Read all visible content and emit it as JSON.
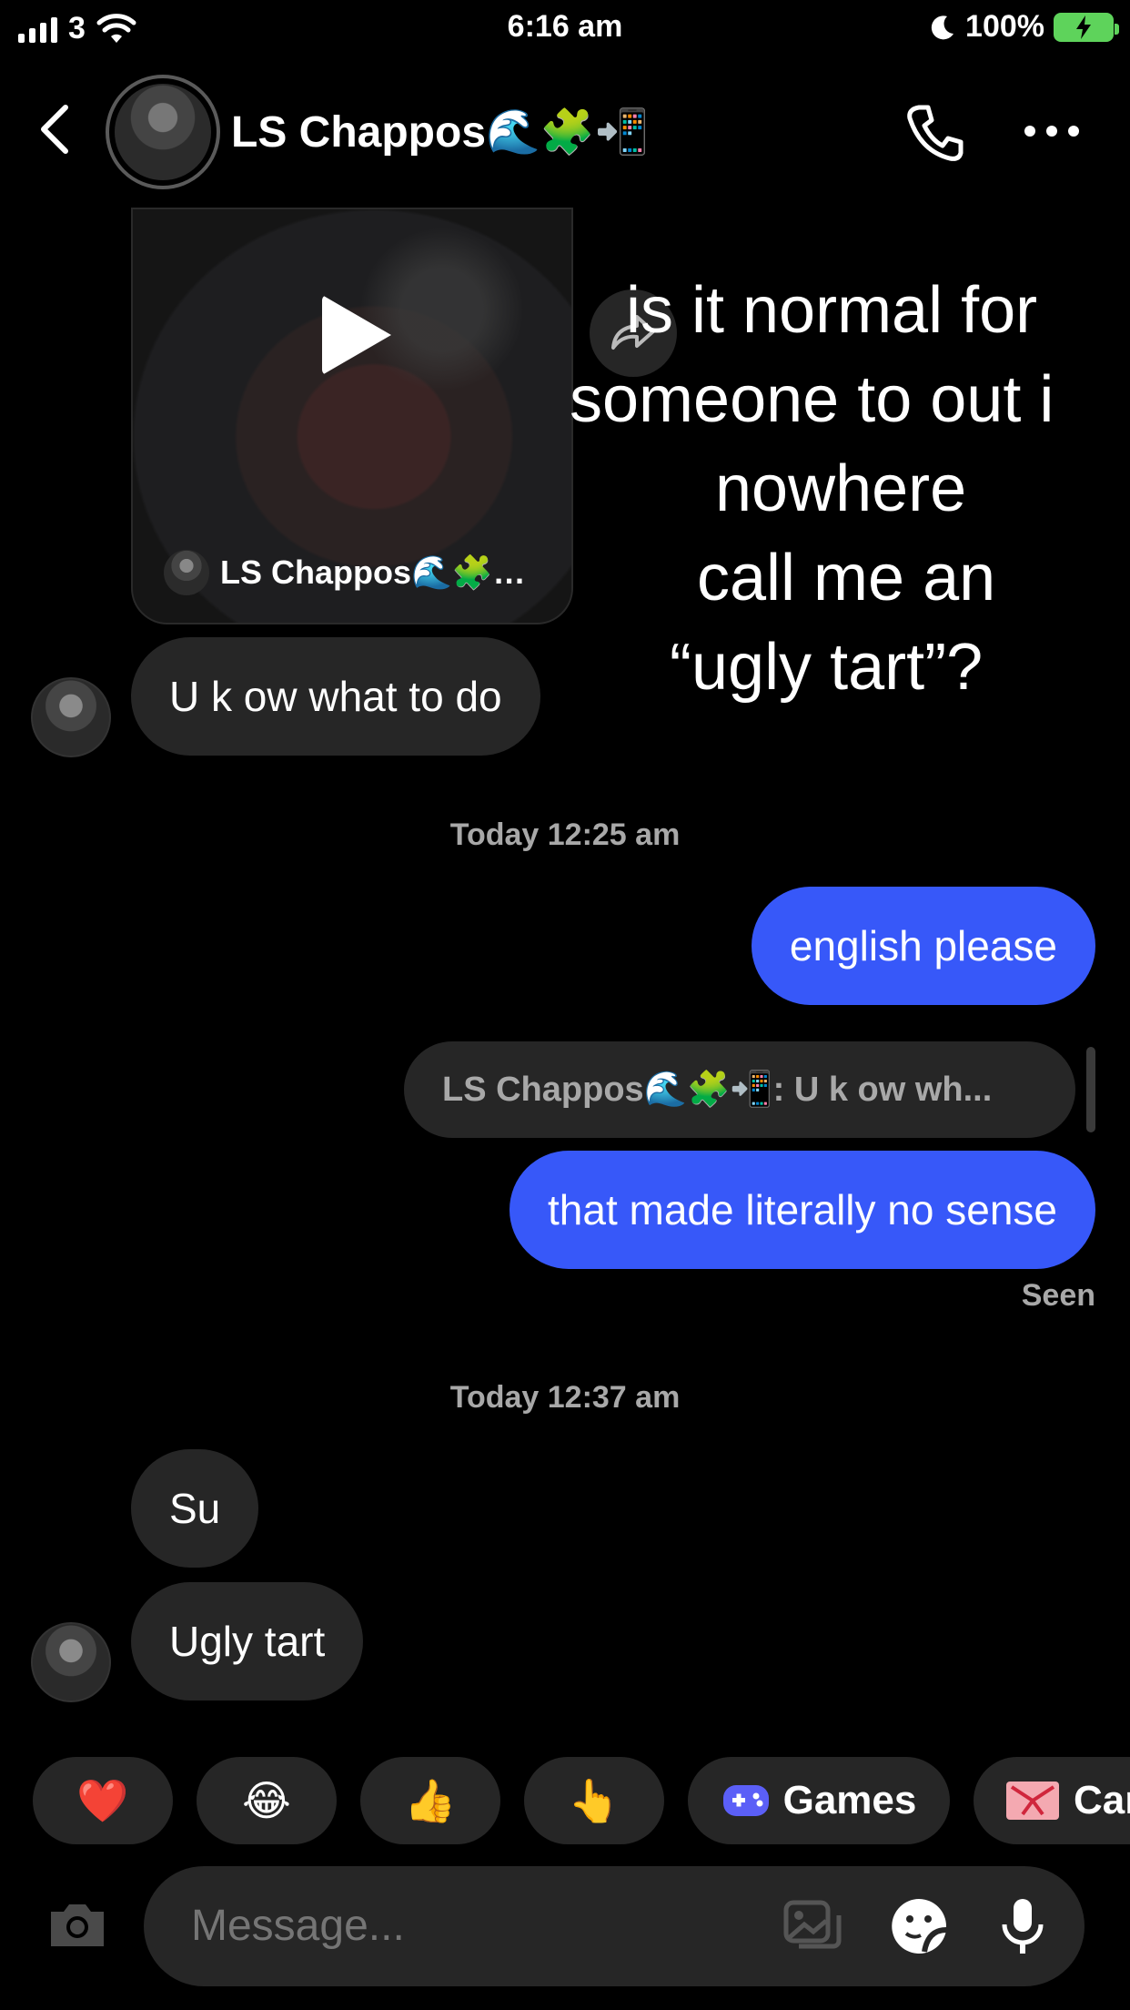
{
  "status_bar": {
    "carrier": "3",
    "time": "6:16 am",
    "battery": "100%"
  },
  "header": {
    "title": "LS Chappos🌊🧩📲"
  },
  "shared_reel": {
    "author": "LS Chappos🌊🧩…",
    "overlay_lines": [
      "is it normal for",
      "someone to out i",
      "nowhere",
      "call me an",
      "“ugly tart”?"
    ]
  },
  "messages": [
    {
      "text": "U k ow what to do"
    },
    {
      "stamp": "Today 12:25 am"
    },
    {
      "text": "english please"
    },
    {
      "reply_preview": "LS Chappos🌊🧩📲: U k ow wh..."
    },
    {
      "text": "that made literally no sense"
    },
    {
      "seen": "Seen"
    },
    {
      "stamp": "Today 12:37 am"
    },
    {
      "text": "Su"
    },
    {
      "text": "Ugly tart"
    }
  ],
  "quick_reactions": [
    {
      "emoji": "❤️"
    },
    {
      "emoji": "😂"
    },
    {
      "emoji": "👍"
    },
    {
      "emoji": "👆"
    },
    {
      "label": "Games",
      "icon": "gamepad-icon"
    },
    {
      "label": "Car",
      "icon": "gift-icon"
    }
  ],
  "composer": {
    "placeholder": "Message..."
  },
  "colors": {
    "outgoing_bubble": "#3758f9",
    "incoming_bubble": "#262626",
    "battery": "#5ed35b"
  }
}
